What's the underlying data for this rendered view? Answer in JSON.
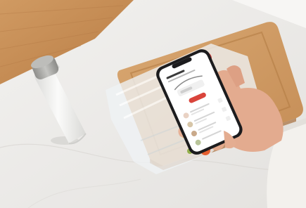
{
  "scene": {
    "subject": "hand-holding-smartphone-with-recipe-app",
    "objects": [
      "white-thermos-bottle",
      "wooden-cutting-board",
      "vacuum-sealed-food-bag",
      "smartphone",
      "hand"
    ]
  },
  "colors": {
    "wall_wood": "#c98f55",
    "marble": "#eceae7",
    "board": "#cf9a62",
    "board_dark": "#b67f47",
    "bottle": "#f3f3f1",
    "cap": "#a9a9a6",
    "phone_frame": "#1c1c1e",
    "screen": "#ffffff",
    "accent_red": "#d9443b",
    "skin": "#e7b49a",
    "sleeve": "#f4f2ee",
    "plastic": "#e9eef0"
  }
}
